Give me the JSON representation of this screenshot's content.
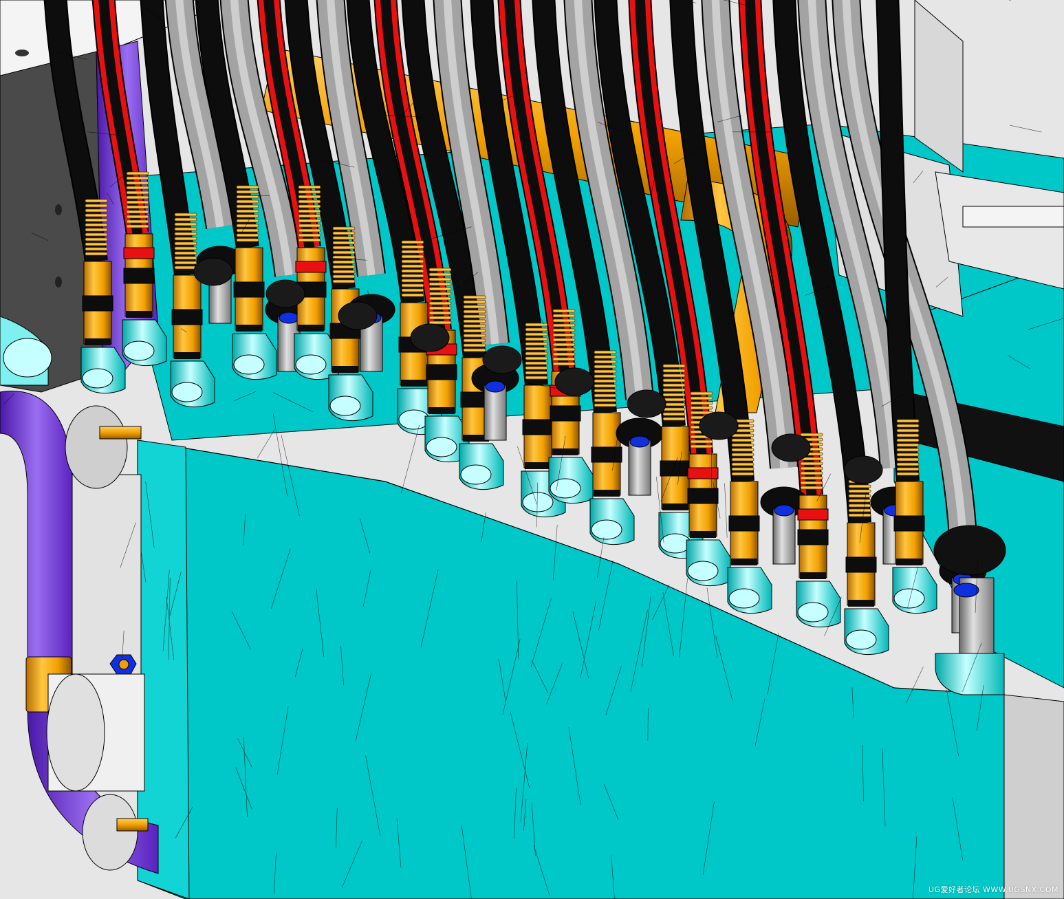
{
  "watermark": {
    "text": "UG爱好者论坛 WWW.UGSNX.COM"
  },
  "colors": {
    "cyan": "#00c8c8",
    "cyan_light": "#7ff0f0",
    "cyan_hi": "#c6ffff",
    "orange": "#f2a000",
    "orange_light": "#ffc640",
    "orange_dark": "#b86e00",
    "black": "#0d0d0d",
    "red": "#e81010",
    "gray": "#a3a3a3",
    "gray_light": "#d8d8d8",
    "gray_dark": "#4a4a4a",
    "purple": "#6e2ed6",
    "purple_light": "#9a6ef0",
    "blue": "#1030e0",
    "white": "#f4f4f4",
    "outline": "#000000"
  },
  "scene": {
    "description_icon": "cad-assembly-render",
    "hose_types": [
      "black-hose",
      "red-hose",
      "gray-hose"
    ],
    "fitting_icon": "spring-coil-fitting"
  }
}
